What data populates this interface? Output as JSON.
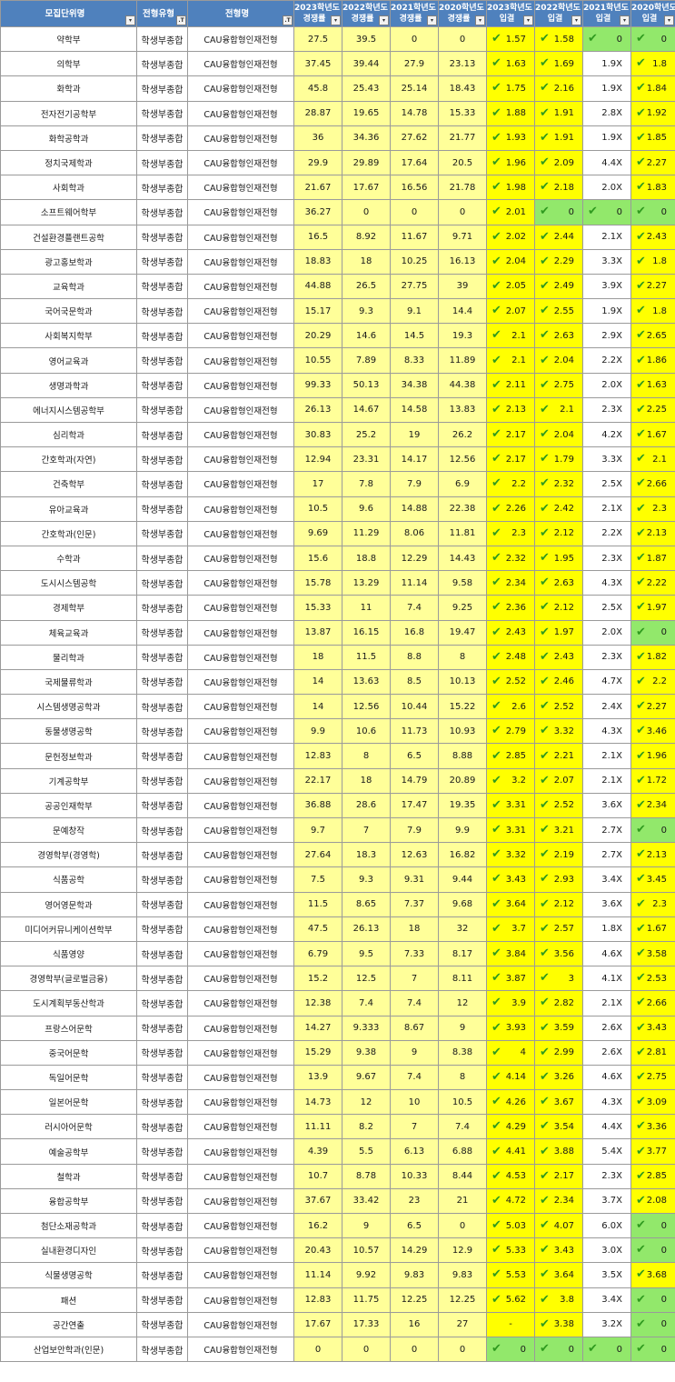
{
  "headers": [
    {
      "l1": "모집단위명",
      "l2": "",
      "filter": "▾"
    },
    {
      "l1": "전형유형",
      "l2": "",
      "filter": ".T"
    },
    {
      "l1": "전형명",
      "l2": "",
      "filter": ".T"
    },
    {
      "l1": "2023학년도",
      "l2": "경쟁률",
      "filter": "▾"
    },
    {
      "l1": "2022학년도",
      "l2": "경쟁률",
      "filter": "▾"
    },
    {
      "l1": "2021학년도",
      "l2": "경쟁률",
      "filter": "▾"
    },
    {
      "l1": "2020학년도",
      "l2": "경쟁률",
      "filter": "▾"
    },
    {
      "l1": "2023학년도",
      "l2": "입결",
      "filter": "▾"
    },
    {
      "l1": "2022학년도",
      "l2": "입결",
      "filter": "▾"
    },
    {
      "l1": "2021학년도",
      "l2": "입결",
      "filter": "▾"
    },
    {
      "l1": "2020학년도",
      "l2": "입결",
      "filter": "▾"
    }
  ],
  "check_icon": "check-icon",
  "colors": {
    "header": "#4f81bd",
    "competition": "#ffff99",
    "rank": "#ffff00",
    "zero": "#92e86b",
    "check": "#2f9a1f"
  },
  "rows": [
    [
      "약학부",
      "학생부종합",
      "CAU융합형인재전형",
      "27.5",
      "39.5",
      "0",
      "0",
      "1.57",
      "1.58",
      "0",
      "0"
    ],
    [
      "의학부",
      "학생부종합",
      "CAU융합형인재전형",
      "37.45",
      "39.44",
      "27.9",
      "23.13",
      "1.63",
      "1.69",
      "1.9X",
      "1.8"
    ],
    [
      "화학과",
      "학생부종합",
      "CAU융합형인재전형",
      "45.8",
      "25.43",
      "25.14",
      "18.43",
      "1.75",
      "2.16",
      "1.9X",
      "1.84"
    ],
    [
      "전자전기공학부",
      "학생부종합",
      "CAU융합형인재전형",
      "28.87",
      "19.65",
      "14.78",
      "15.33",
      "1.88",
      "1.91",
      "2.8X",
      "1.92"
    ],
    [
      "화학공학과",
      "학생부종합",
      "CAU융합형인재전형",
      "36",
      "34.36",
      "27.62",
      "21.77",
      "1.93",
      "1.91",
      "1.9X",
      "1.85"
    ],
    [
      "정치국제학과",
      "학생부종합",
      "CAU융합형인재전형",
      "29.9",
      "29.89",
      "17.64",
      "20.5",
      "1.96",
      "2.09",
      "4.4X",
      "2.27"
    ],
    [
      "사회학과",
      "학생부종합",
      "CAU융합형인재전형",
      "21.67",
      "17.67",
      "16.56",
      "21.78",
      "1.98",
      "2.18",
      "2.0X",
      "1.83"
    ],
    [
      "소프트웨어학부",
      "학생부종합",
      "CAU융합형인재전형",
      "36.27",
      "0",
      "0",
      "0",
      "2.01",
      "0",
      "0",
      "0"
    ],
    [
      "건설환경플랜트공학",
      "학생부종합",
      "CAU융합형인재전형",
      "16.5",
      "8.92",
      "11.67",
      "9.71",
      "2.02",
      "2.44",
      "2.1X",
      "2.43"
    ],
    [
      "광고홍보학과",
      "학생부종합",
      "CAU융합형인재전형",
      "18.83",
      "18",
      "10.25",
      "16.13",
      "2.04",
      "2.29",
      "3.3X",
      "1.8"
    ],
    [
      "교육학과",
      "학생부종합",
      "CAU융합형인재전형",
      "44.88",
      "26.5",
      "27.75",
      "39",
      "2.05",
      "2.49",
      "3.9X",
      "2.27"
    ],
    [
      "국어국문학과",
      "학생부종합",
      "CAU융합형인재전형",
      "15.17",
      "9.3",
      "9.1",
      "14.4",
      "2.07",
      "2.55",
      "1.9X",
      "1.8"
    ],
    [
      "사회복지학부",
      "학생부종합",
      "CAU융합형인재전형",
      "20.29",
      "14.6",
      "14.5",
      "19.3",
      "2.1",
      "2.63",
      "2.9X",
      "2.65"
    ],
    [
      "영어교육과",
      "학생부종합",
      "CAU융합형인재전형",
      "10.55",
      "7.89",
      "8.33",
      "11.89",
      "2.1",
      "2.04",
      "2.2X",
      "1.86"
    ],
    [
      "생명과학과",
      "학생부종합",
      "CAU융합형인재전형",
      "99.33",
      "50.13",
      "34.38",
      "44.38",
      "2.11",
      "2.75",
      "2.0X",
      "1.63"
    ],
    [
      "에너지시스템공학부",
      "학생부종합",
      "CAU융합형인재전형",
      "26.13",
      "14.67",
      "14.58",
      "13.83",
      "2.13",
      "2.1",
      "2.3X",
      "2.25"
    ],
    [
      "심리학과",
      "학생부종합",
      "CAU융합형인재전형",
      "30.83",
      "25.2",
      "19",
      "26.2",
      "2.17",
      "2.04",
      "4.2X",
      "1.67"
    ],
    [
      "간호학과(자연)",
      "학생부종합",
      "CAU융합형인재전형",
      "12.94",
      "23.31",
      "14.17",
      "12.56",
      "2.17",
      "1.79",
      "3.3X",
      "2.1"
    ],
    [
      "건축학부",
      "학생부종합",
      "CAU융합형인재전형",
      "17",
      "7.8",
      "7.9",
      "6.9",
      "2.2",
      "2.32",
      "2.5X",
      "2.66"
    ],
    [
      "유아교육과",
      "학생부종합",
      "CAU융합형인재전형",
      "10.5",
      "9.6",
      "14.88",
      "22.38",
      "2.26",
      "2.42",
      "2.1X",
      "2.3"
    ],
    [
      "간호학과(인문)",
      "학생부종합",
      "CAU융합형인재전형",
      "9.69",
      "11.29",
      "8.06",
      "11.81",
      "2.3",
      "2.12",
      "2.2X",
      "2.13"
    ],
    [
      "수학과",
      "학생부종합",
      "CAU융합형인재전형",
      "15.6",
      "18.8",
      "12.29",
      "14.43",
      "2.32",
      "1.95",
      "2.3X",
      "1.87"
    ],
    [
      "도시시스템공학",
      "학생부종합",
      "CAU융합형인재전형",
      "15.78",
      "13.29",
      "11.14",
      "9.58",
      "2.34",
      "2.63",
      "4.3X",
      "2.22"
    ],
    [
      "경제학부",
      "학생부종합",
      "CAU융합형인재전형",
      "15.33",
      "11",
      "7.4",
      "9.25",
      "2.36",
      "2.12",
      "2.5X",
      "1.97"
    ],
    [
      "체육교육과",
      "학생부종합",
      "CAU융합형인재전형",
      "13.87",
      "16.15",
      "16.8",
      "19.47",
      "2.43",
      "1.97",
      "2.0X",
      "0"
    ],
    [
      "물리학과",
      "학생부종합",
      "CAU융합형인재전형",
      "18",
      "11.5",
      "8.8",
      "8",
      "2.48",
      "2.43",
      "2.3X",
      "1.82"
    ],
    [
      "국제물류학과",
      "학생부종합",
      "CAU융합형인재전형",
      "14",
      "13.63",
      "8.5",
      "10.13",
      "2.52",
      "2.46",
      "4.7X",
      "2.2"
    ],
    [
      "시스템생명공학과",
      "학생부종합",
      "CAU융합형인재전형",
      "14",
      "12.56",
      "10.44",
      "15.22",
      "2.6",
      "2.52",
      "2.4X",
      "2.27"
    ],
    [
      "동물생명공학",
      "학생부종합",
      "CAU융합형인재전형",
      "9.9",
      "10.6",
      "11.73",
      "10.93",
      "2.79",
      "3.32",
      "4.3X",
      "3.46"
    ],
    [
      "문헌정보학과",
      "학생부종합",
      "CAU융합형인재전형",
      "12.83",
      "8",
      "6.5",
      "8.88",
      "2.85",
      "2.21",
      "2.1X",
      "1.96"
    ],
    [
      "기계공학부",
      "학생부종합",
      "CAU융합형인재전형",
      "22.17",
      "18",
      "14.79",
      "20.89",
      "3.2",
      "2.07",
      "2.1X",
      "1.72"
    ],
    [
      "공공인재학부",
      "학생부종합",
      "CAU융합형인재전형",
      "36.88",
      "28.6",
      "17.47",
      "19.35",
      "3.31",
      "2.52",
      "3.6X",
      "2.34"
    ],
    [
      "문예창작",
      "학생부종합",
      "CAU융합형인재전형",
      "9.7",
      "7",
      "7.9",
      "9.9",
      "3.31",
      "3.21",
      "2.7X",
      "0"
    ],
    [
      "경영학부(경영학)",
      "학생부종합",
      "CAU융합형인재전형",
      "27.64",
      "18.3",
      "12.63",
      "16.82",
      "3.32",
      "2.19",
      "2.7X",
      "2.13"
    ],
    [
      "식품공학",
      "학생부종합",
      "CAU융합형인재전형",
      "7.5",
      "9.3",
      "9.31",
      "9.44",
      "3.43",
      "2.93",
      "3.4X",
      "3.45"
    ],
    [
      "영어영문학과",
      "학생부종합",
      "CAU융합형인재전형",
      "11.5",
      "8.65",
      "7.37",
      "9.68",
      "3.64",
      "2.12",
      "3.6X",
      "2.3"
    ],
    [
      "미디어커뮤니케이션학부",
      "학생부종합",
      "CAU융합형인재전형",
      "47.5",
      "26.13",
      "18",
      "32",
      "3.7",
      "2.57",
      "1.8X",
      "1.67"
    ],
    [
      "식품영양",
      "학생부종합",
      "CAU융합형인재전형",
      "6.79",
      "9.5",
      "7.33",
      "8.17",
      "3.84",
      "3.56",
      "4.6X",
      "3.58"
    ],
    [
      "경영학부(글로벌금융)",
      "학생부종합",
      "CAU융합형인재전형",
      "15.2",
      "12.5",
      "7",
      "8.11",
      "3.87",
      "3",
      "4.1X",
      "2.53"
    ],
    [
      "도시계획부동산학과",
      "학생부종합",
      "CAU융합형인재전형",
      "12.38",
      "7.4",
      "7.4",
      "12",
      "3.9",
      "2.82",
      "2.1X",
      "2.66"
    ],
    [
      "프랑스어문학",
      "학생부종합",
      "CAU융합형인재전형",
      "14.27",
      "9.333",
      "8.67",
      "9",
      "3.93",
      "3.59",
      "2.6X",
      "3.43"
    ],
    [
      "중국어문학",
      "학생부종합",
      "CAU융합형인재전형",
      "15.29",
      "9.38",
      "9",
      "8.38",
      "4",
      "2.99",
      "2.6X",
      "2.81"
    ],
    [
      "독일어문학",
      "학생부종합",
      "CAU융합형인재전형",
      "13.9",
      "9.67",
      "7.4",
      "8",
      "4.14",
      "3.26",
      "4.6X",
      "2.75"
    ],
    [
      "일본어문학",
      "학생부종합",
      "CAU융합형인재전형",
      "14.73",
      "12",
      "10",
      "10.5",
      "4.26",
      "3.67",
      "4.3X",
      "3.09"
    ],
    [
      "러시아어문학",
      "학생부종합",
      "CAU융합형인재전형",
      "11.11",
      "8.2",
      "7",
      "7.4",
      "4.29",
      "3.54",
      "4.4X",
      "3.36"
    ],
    [
      "예술공학부",
      "학생부종합",
      "CAU융합형인재전형",
      "4.39",
      "5.5",
      "6.13",
      "6.88",
      "4.41",
      "3.88",
      "5.4X",
      "3.77"
    ],
    [
      "철학과",
      "학생부종합",
      "CAU융합형인재전형",
      "10.7",
      "8.78",
      "10.33",
      "8.44",
      "4.53",
      "2.17",
      "2.3X",
      "2.85"
    ],
    [
      "융합공학부",
      "학생부종합",
      "CAU융합형인재전형",
      "37.67",
      "33.42",
      "23",
      "21",
      "4.72",
      "2.34",
      "3.7X",
      "2.08"
    ],
    [
      "첨단소재공학과",
      "학생부종합",
      "CAU융합형인재전형",
      "16.2",
      "9",
      "6.5",
      "0",
      "5.03",
      "4.07",
      "6.0X",
      "0"
    ],
    [
      "실내환경디자인",
      "학생부종합",
      "CAU융합형인재전형",
      "20.43",
      "10.57",
      "14.29",
      "12.9",
      "5.33",
      "3.43",
      "3.0X",
      "0"
    ],
    [
      "식물생명공학",
      "학생부종합",
      "CAU융합형인재전형",
      "11.14",
      "9.92",
      "9.83",
      "9.83",
      "5.53",
      "3.64",
      "3.5X",
      "3.68"
    ],
    [
      "패션",
      "학생부종합",
      "CAU융합형인재전형",
      "12.83",
      "11.75",
      "12.25",
      "12.25",
      "5.62",
      "3.8",
      "3.4X",
      "0"
    ],
    [
      "공간연출",
      "학생부종합",
      "CAU융합형인재전형",
      "17.67",
      "17.33",
      "16",
      "27",
      "-",
      "3.38",
      "3.2X",
      "0"
    ],
    [
      "산업보안학과(인문)",
      "학생부종합",
      "CAU융합형인재전형",
      "0",
      "0",
      "0",
      "0",
      "0",
      "0",
      "0",
      "0"
    ]
  ]
}
